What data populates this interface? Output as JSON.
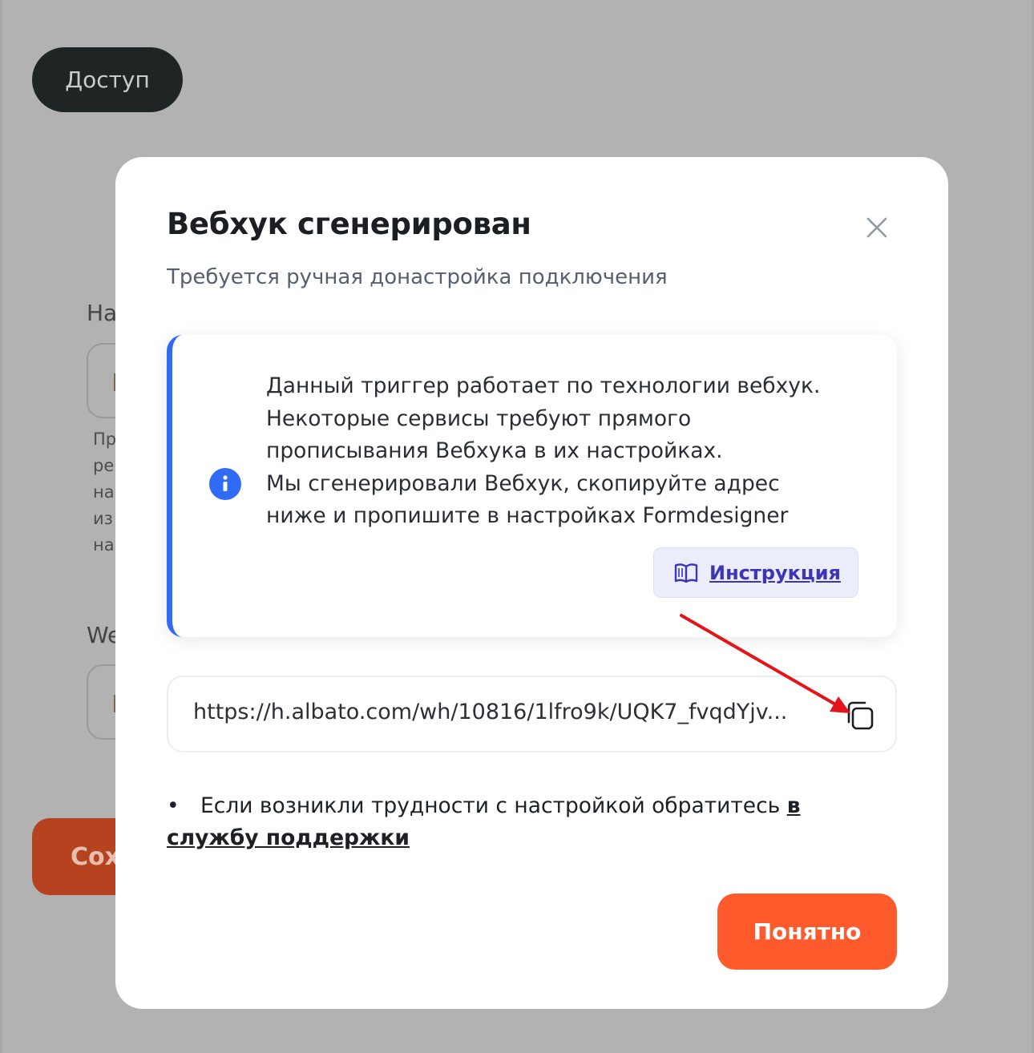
{
  "background": {
    "access_button": "Доступ",
    "name_label": "На",
    "hint_lines": [
      "Пр",
      "ре",
      "на",
      "из",
      "на"
    ],
    "webhook_label": "We",
    "save_button": "Сох"
  },
  "modal": {
    "title": "Вебхук сгенерирован",
    "subtitle": "Требуется ручная донастройка подключения",
    "info": {
      "lines": [
        "Данный триггер работает по технологии вебхук.",
        "Некоторые сервисы требуют прямого",
        "прописывания Вебхука в их настройках.",
        "Мы сгенерировали Вебхук, скопируйте адрес",
        "ниже и пропишите в настройках Formdesigner"
      ],
      "instruction_label": "Инструкция"
    },
    "webhook_url": "https://h.albato.com/wh/10816/1lfro9k/UQK7_fvqdYjv...",
    "help": {
      "bullet": "•",
      "text": "Если возникли трудности с настройкой обратитесь ",
      "link": "в службу поддержки"
    },
    "ok_button": "Понятно"
  },
  "colors": {
    "accent_orange": "#ff5a2b",
    "info_border_blue": "#2f6bf5",
    "instruction_purple": "#3c34b9",
    "annotation_arrow": "#e4141b"
  },
  "icons": [
    "close-icon",
    "info-icon",
    "book-icon",
    "copy-icon",
    "annotation-arrow"
  ]
}
